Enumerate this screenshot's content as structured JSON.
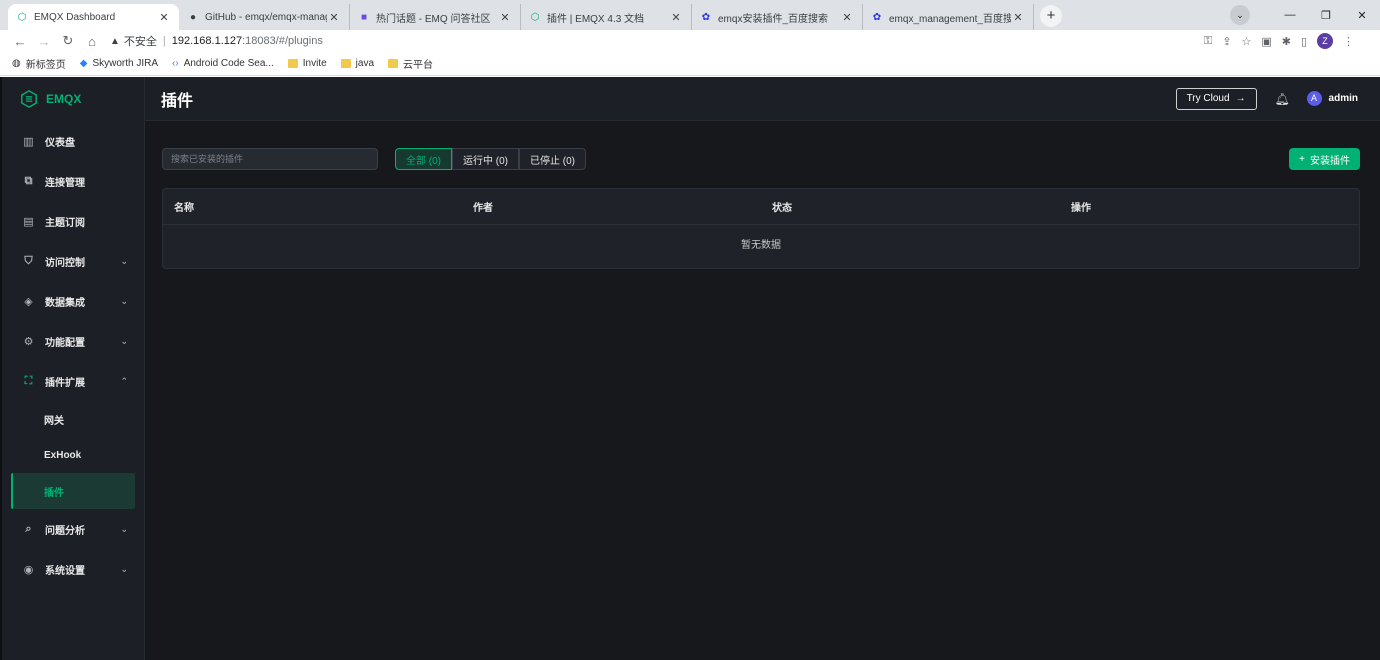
{
  "browser": {
    "tabs": [
      {
        "title": "EMQX Dashboard",
        "icon": "emqx-hex-icon",
        "active": true
      },
      {
        "title": "GitHub - emqx/emqx-manage",
        "icon": "github-icon",
        "active": false
      },
      {
        "title": "热门话题 - EMQ 问答社区",
        "icon": "forum-icon",
        "active": false
      },
      {
        "title": "插件 | EMQX 4.3 文档",
        "icon": "emqx-hex-icon",
        "active": false
      },
      {
        "title": "emqx安装插件_百度搜索",
        "icon": "baidu-icon",
        "active": false
      },
      {
        "title": "emqx_management_百度搜索",
        "icon": "baidu-icon",
        "active": false
      }
    ],
    "security_label": "不安全",
    "url_host": "192.168.1.127",
    "url_path": ":18083/#/plugins",
    "profile_initial": "Z",
    "bookmarks": [
      {
        "label": "新标签页",
        "icon": "globe-icon"
      },
      {
        "label": "Skyworth JIRA",
        "icon": "jira-icon"
      },
      {
        "label": "Android Code Sea...",
        "icon": "code-icon"
      },
      {
        "label": "Invite",
        "icon": "folder-icon"
      },
      {
        "label": "java",
        "icon": "folder-icon"
      },
      {
        "label": "云平台",
        "icon": "folder-icon"
      }
    ]
  },
  "app": {
    "logo_text": "EMQX",
    "accent_color": "#00b173",
    "menu": [
      {
        "label": "仪表盘",
        "icon": "dashboard-icon",
        "expandable": false
      },
      {
        "label": "连接管理",
        "icon": "connections-icon",
        "expandable": false
      },
      {
        "label": "主题订阅",
        "icon": "subscriptions-icon",
        "expandable": false
      },
      {
        "label": "访问控制",
        "icon": "shield-icon",
        "expandable": true,
        "expanded": false
      },
      {
        "label": "数据集成",
        "icon": "data-integration-icon",
        "expandable": true,
        "expanded": false
      },
      {
        "label": "功能配置",
        "icon": "gear-icon",
        "expandable": true,
        "expanded": false
      },
      {
        "label": "插件扩展",
        "icon": "extension-icon",
        "expandable": true,
        "expanded": true
      },
      {
        "label": "问题分析",
        "icon": "diagnose-icon",
        "expandable": true,
        "expanded": false
      },
      {
        "label": "系统设置",
        "icon": "settings-stack-icon",
        "expandable": true,
        "expanded": false
      }
    ],
    "submenu": [
      {
        "label": "网关",
        "active": false
      },
      {
        "label": "ExHook",
        "active": false
      },
      {
        "label": "插件",
        "active": true
      }
    ],
    "header": {
      "title": "插件",
      "try_cloud": "Try Cloud",
      "user_initial": "A",
      "username": "admin"
    },
    "toolbar": {
      "search_placeholder": "搜索已安装的插件",
      "filters": [
        "全部 (0)",
        "运行中 (0)",
        "已停止 (0)"
      ],
      "active_filter": 0,
      "install_label": "安装插件"
    },
    "table": {
      "columns": [
        "名称",
        "作者",
        "状态",
        "操作"
      ],
      "empty_text": "暂无数据"
    }
  }
}
